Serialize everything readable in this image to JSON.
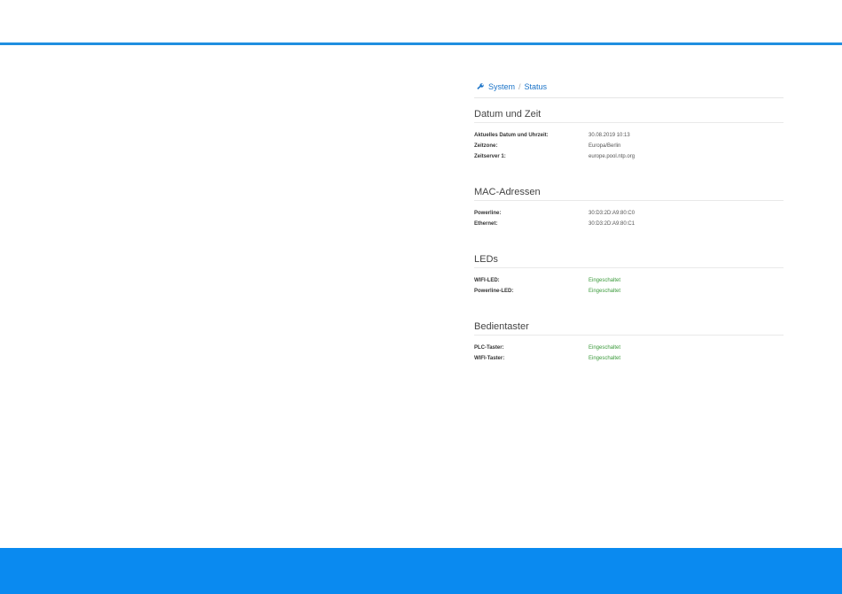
{
  "breadcrumb": {
    "icon": "wrench-icon",
    "items": [
      "System",
      "Status"
    ],
    "separator": "/"
  },
  "sections": {
    "datetime": {
      "title": "Datum und Zeit",
      "rows": [
        {
          "label": "Aktuelles Datum und Uhrzeit:",
          "value": "30.08.2019 10:13"
        },
        {
          "label": "Zeitzone:",
          "value": "Europa/Berlin"
        },
        {
          "label": "Zeitserver 1:",
          "value": "europe.pool.ntp.org"
        }
      ]
    },
    "mac": {
      "title": "MAC-Adressen",
      "rows": [
        {
          "label": "Powerline:",
          "value": "30:D3:2D:A9:80:C0"
        },
        {
          "label": "Ethernet:",
          "value": "30:D3:2D:A9:80:C1"
        }
      ]
    },
    "leds": {
      "title": "LEDs",
      "rows": [
        {
          "label": "WIFI-LED:",
          "value": "Eingeschaltet"
        },
        {
          "label": "Powerline-LED:",
          "value": "Eingeschaltet"
        }
      ]
    },
    "buttons": {
      "title": "Bedientaster",
      "rows": [
        {
          "label": "PLC-Taster:",
          "value": "Eingeschaltet"
        },
        {
          "label": "WIFI-Taster:",
          "value": "Eingeschaltet"
        }
      ]
    }
  },
  "colors": {
    "accent": "#1f8fe0",
    "footer": "#0a8af0",
    "status_on": "#3a9a3a"
  }
}
